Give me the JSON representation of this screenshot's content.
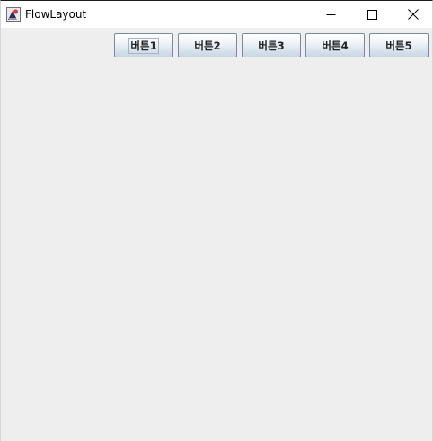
{
  "window": {
    "title": "FlowLayout",
    "app_icon": "java-duke-icon",
    "controls": {
      "minimize_icon": "minimize-icon",
      "maximize_icon": "maximize-icon",
      "close_icon": "close-icon"
    }
  },
  "content": {
    "background": "#eeeeee",
    "buttons": [
      {
        "label": "버튼1",
        "focused": true
      },
      {
        "label": "버튼2",
        "focused": false
      },
      {
        "label": "버튼3",
        "focused": false
      },
      {
        "label": "버튼4",
        "focused": false
      },
      {
        "label": "버튼5",
        "focused": false
      }
    ]
  }
}
